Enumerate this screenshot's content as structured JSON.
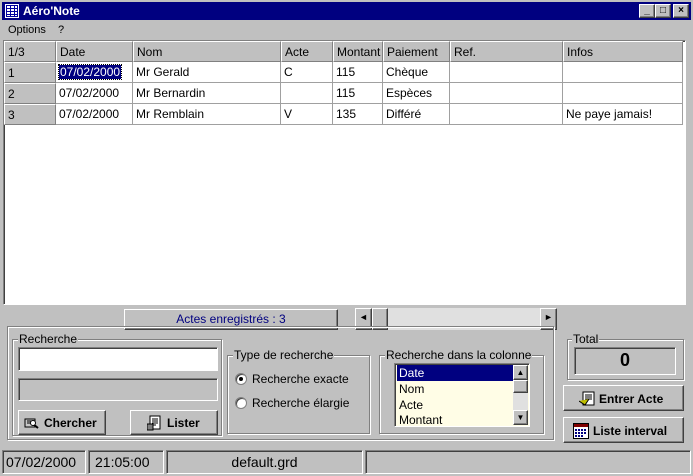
{
  "window": {
    "title": "Aéro'Note",
    "controls": {
      "minimize": "_",
      "maximize": "□",
      "close": "×"
    }
  },
  "menu": {
    "items": [
      "Options",
      "?"
    ]
  },
  "grid": {
    "corner": "1/3",
    "columns": [
      "Date",
      "Nom",
      "Acte",
      "Montant",
      "Paiement",
      "Ref.",
      "Infos"
    ],
    "rows": [
      {
        "num": "1",
        "cells": [
          "07/02/2000",
          "Mr Gerald",
          "C",
          "115",
          "Chèque",
          "",
          ""
        ]
      },
      {
        "num": "2",
        "cells": [
          "07/02/2000",
          "Mr Bernardin",
          "",
          "115",
          "Espèces",
          "",
          ""
        ]
      },
      {
        "num": "3",
        "cells": [
          "07/02/2000",
          "Mr Remblain",
          "V",
          "135",
          "Différé",
          "",
          "Ne paye jamais!"
        ]
      }
    ]
  },
  "count_bar": {
    "text": "Actes enregistrés : 3"
  },
  "scrollbar": {
    "left_arrow": "◄",
    "right_arrow": "►"
  },
  "recherche": {
    "label": "Recherche",
    "input_value": "",
    "second_value": "",
    "chercher_label": "Chercher",
    "lister_label": "Lister"
  },
  "type_recherche": {
    "label": "Type de recherche",
    "options": [
      "Recherche exacte",
      "Recherche élargie"
    ],
    "selected": 0
  },
  "colonne": {
    "label": "Recherche dans la colonne",
    "items": [
      "Date",
      "Nom",
      "Acte",
      "Montant"
    ],
    "selected": 0,
    "up_arrow": "▲",
    "down_arrow": "▼"
  },
  "total": {
    "label": "Total",
    "value": "0"
  },
  "actions": {
    "entrer_acte": "Entrer Acte",
    "liste_interval": "Liste interval"
  },
  "status": {
    "date": "07/02/2000",
    "time": "21:05:00",
    "file": "default.grd",
    "extra": ""
  },
  "colors": {
    "titlebar": "#000080",
    "selection": "#000080",
    "count_text": "#000080",
    "list_bg": "#fffde6"
  }
}
